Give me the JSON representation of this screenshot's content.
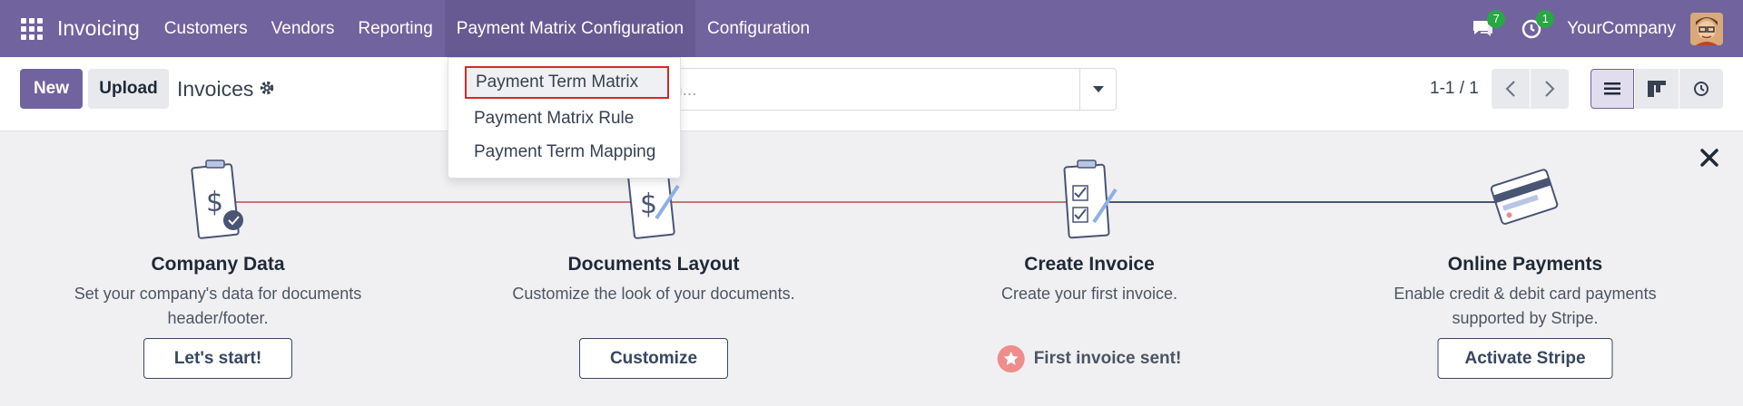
{
  "navbar": {
    "app_name": "Invoicing",
    "menu": [
      "Customers",
      "Vendors",
      "Reporting",
      "Payment Matrix Configuration",
      "Configuration"
    ],
    "messages_count": "7",
    "activities_count": "1",
    "company": "YourCompany"
  },
  "dropdown": {
    "items": [
      "Payment Term Matrix",
      "Payment Matrix Rule",
      "Payment Term Mapping"
    ]
  },
  "control": {
    "new_label": "New",
    "upload_label": "Upload",
    "title": "Invoices",
    "search_placeholder": "h...",
    "pager": "1-1 / 1"
  },
  "onboarding": {
    "steps": [
      {
        "title": "Company Data",
        "desc": "Set your company's data for documents header/footer.",
        "button": "Let's start!"
      },
      {
        "title": "Documents Layout",
        "desc": "Customize the look of your documents.",
        "button": "Customize"
      },
      {
        "title": "Create Invoice",
        "desc": "Create your first invoice.",
        "done": "First invoice sent!"
      },
      {
        "title": "Online Payments",
        "desc": "Enable credit & debit card payments supported by Stripe.",
        "button": "Activate Stripe"
      }
    ]
  },
  "colors": {
    "brand": "#71639e",
    "highlight_border": "#dc2626",
    "success_badge": "#28a745"
  }
}
